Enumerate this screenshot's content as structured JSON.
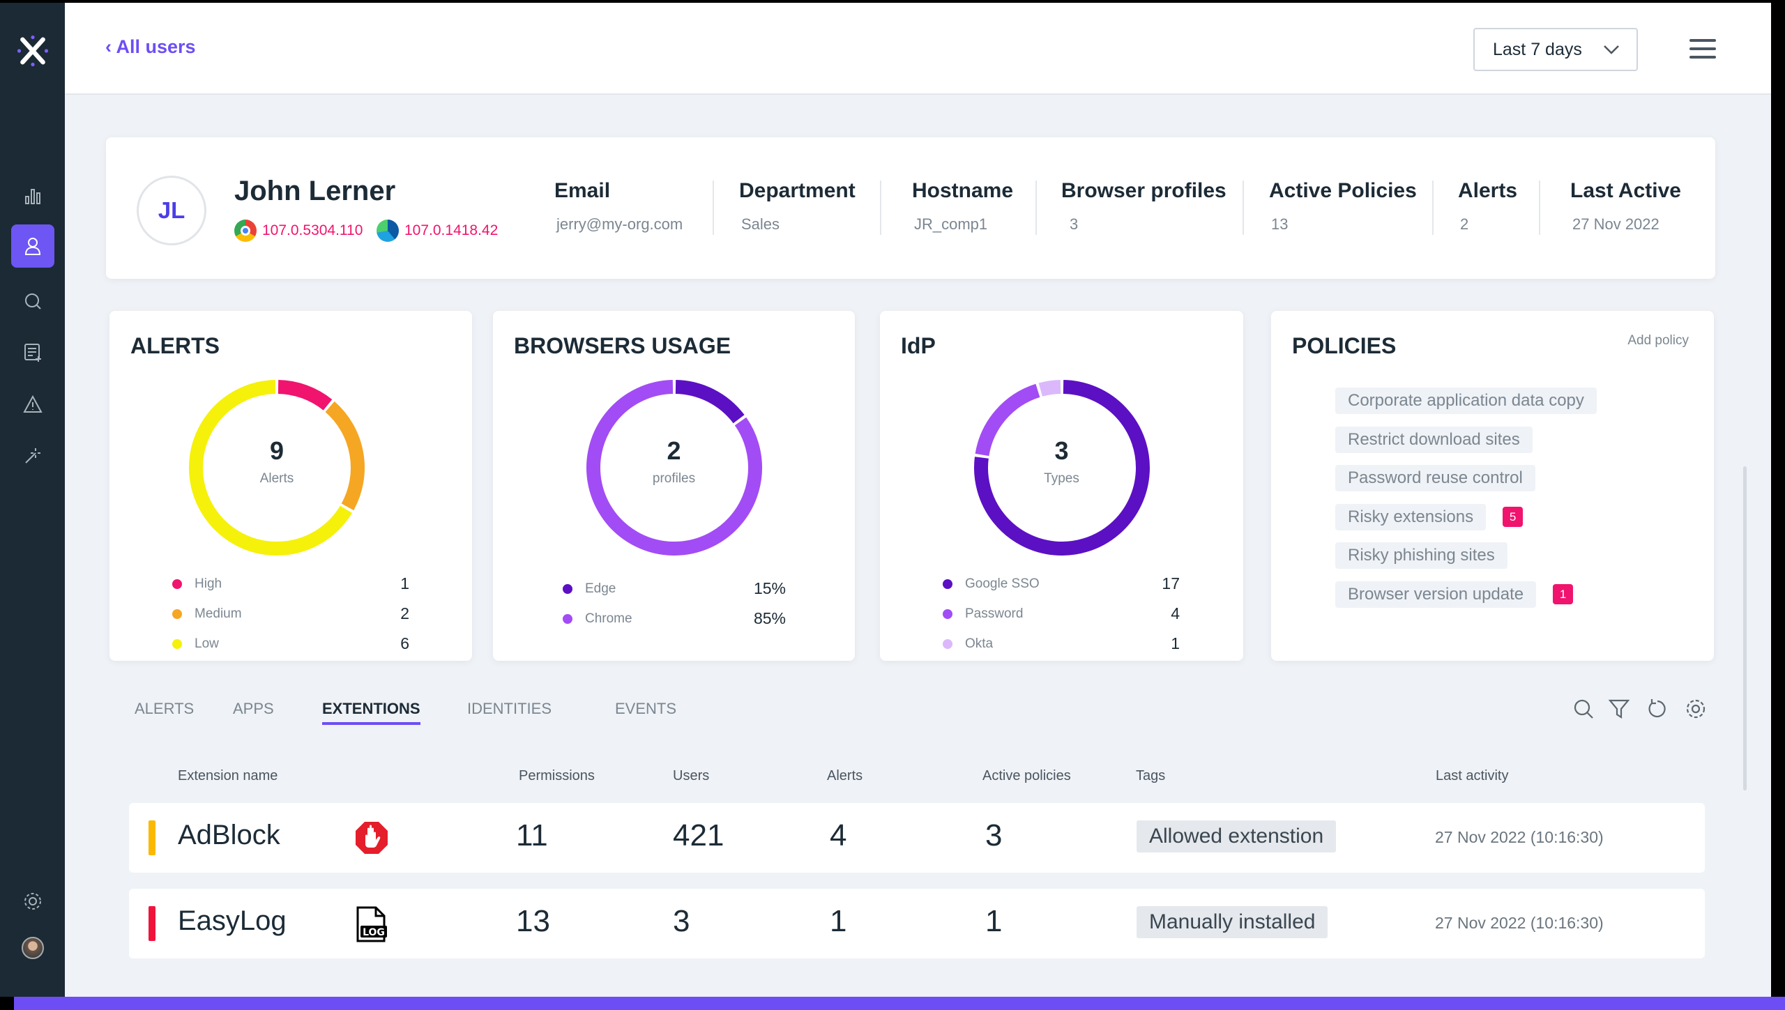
{
  "header": {
    "back_label": "‹ All users",
    "range": "Last 7 days"
  },
  "profile": {
    "initials": "JL",
    "name": "John Lerner",
    "chrome_version": "107.0.5304.110",
    "edge_version": "107.0.1418.42",
    "fields": [
      {
        "label": "Email",
        "value": "jerry@my-org.com"
      },
      {
        "label": "Department",
        "value": "Sales"
      },
      {
        "label": "Hostname",
        "value": "JR_comp1"
      },
      {
        "label": "Browser profiles",
        "value": "3"
      },
      {
        "label": "Active Policies",
        "value": "13"
      },
      {
        "label": "Alerts",
        "value": "2"
      },
      {
        "label": "Last Active",
        "value": "27 Nov 2022"
      }
    ]
  },
  "chart_data": [
    {
      "type": "pie",
      "title": "ALERTS",
      "center_value": "9",
      "center_label": "Alerts",
      "categories": [
        "High",
        "Medium",
        "Low"
      ],
      "values": [
        1,
        2,
        6
      ],
      "labels": [
        "1",
        "2",
        "6"
      ],
      "colors": [
        "#f0146e",
        "#f5a623",
        "#f5f10a"
      ]
    },
    {
      "type": "pie",
      "title": "BROWSERS USAGE",
      "center_value": "2",
      "center_label": "profiles",
      "categories": [
        "Edge",
        "Chrome"
      ],
      "values": [
        15,
        85
      ],
      "labels": [
        "15%",
        "85%"
      ],
      "colors": [
        "#5b10c4",
        "#a24cf5"
      ]
    },
    {
      "type": "pie",
      "title": "IdP",
      "center_value": "3",
      "center_label": "Types",
      "categories": [
        "Google SSO",
        "Password",
        "Okta"
      ],
      "values": [
        17,
        4,
        1
      ],
      "labels": [
        "17",
        "4",
        "1"
      ],
      "colors": [
        "#5b10c4",
        "#a24cf5",
        "#dbb8fb"
      ]
    }
  ],
  "policies": {
    "title": "POLICIES",
    "add_label": "Add policy",
    "items": [
      {
        "label": "Corporate application data copy"
      },
      {
        "label": "Restrict download sites"
      },
      {
        "label": "Password reuse control"
      },
      {
        "label": "Risky extensions",
        "badge": "5"
      },
      {
        "label": "Risky phishing sites"
      },
      {
        "label": "Browser version update",
        "badge": "1"
      }
    ]
  },
  "tabs": [
    "ALERTS",
    "APPS",
    "EXTENTIONS",
    "IDENTITIES",
    "EVENTS"
  ],
  "active_tab": "EXTENTIONS",
  "table": {
    "columns": [
      "Extension name",
      "Permissions",
      "Users",
      "Alerts",
      "Active policies",
      "Tags",
      "Last activity"
    ],
    "rows": [
      {
        "name": "AdBlock",
        "severity_color": "#fbb800",
        "permissions": "11",
        "users": "421",
        "alerts": "4",
        "active_policies": "3",
        "tag": "Allowed extenstion",
        "last_activity": "27 Nov 2022 (10:16:30)"
      },
      {
        "name": "EasyLog",
        "severity_color": "#f0143c",
        "permissions": "13",
        "users": "3",
        "alerts": "1",
        "active_policies": "1",
        "tag": "Manually installed",
        "last_activity": "27 Nov 2022  (10:16:30)"
      }
    ]
  },
  "colors": {
    "accent": "#6d4ef5",
    "sidebar": "#1b2a35",
    "badge": "#f0146e"
  }
}
